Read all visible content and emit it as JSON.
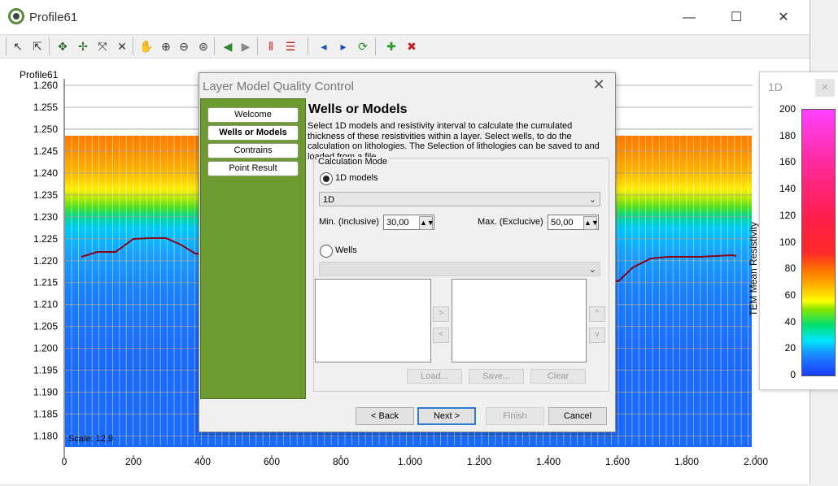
{
  "window": {
    "title": "Profile61",
    "minimize": "—",
    "maximize": "☐",
    "close": "✕"
  },
  "toolbar": {
    "icons": [
      "select-arrow-icon",
      "multi-select-icon",
      "node-edit-icon",
      "node-add-icon",
      "node-move-icon",
      "delete-icon",
      "pan-hand-icon",
      "zoom-in-icon",
      "zoom-out-icon",
      "zoom-extent-icon",
      "back-arrow-icon",
      "forward-arrow-icon",
      "vertical-lines-icon",
      "horizontal-lines-icon",
      "previous-icon",
      "next-icon",
      "refresh-icon",
      "add-model-icon",
      "remove-model-icon"
    ]
  },
  "plot": {
    "profile_label": "Profile61",
    "scale_label": "Scale: 12,9",
    "y_ticks": [
      "1.260",
      "1.255",
      "1.250",
      "1.245",
      "1.240",
      "1.235",
      "1.230",
      "1.225",
      "1.220",
      "1.215",
      "1.210",
      "1.205",
      "1.200",
      "1.195",
      "1.190",
      "1.185",
      "1.180"
    ],
    "x_ticks": [
      "0",
      "200",
      "400",
      "600",
      "800",
      "1.000",
      "1.200",
      "1.400",
      "1.600",
      "1.800",
      "2.000"
    ]
  },
  "dialog": {
    "title": "Layer Model Quality Control",
    "close": "✕",
    "nav": [
      "Welcome",
      "Wells or Models",
      "Contrains",
      "Point Result"
    ],
    "active_nav": "Wells or Models",
    "heading": "Wells or Models",
    "description": "Select 1D models and resistivity interval to calculate the cumulated thickness of these resistivities within a layer. Select wells, to do the calculation on lithologies. The Selection of lithologies can be saved to and loaded from a file.",
    "group_label": "Calculation Mode",
    "radio_models": "1D models",
    "models_value": "1D",
    "min_label": "Min. (Inclusive)",
    "min_value": "30,00",
    "max_label": "Max. (Exclucive)",
    "max_value": "50,00",
    "radio_wells": "Wells",
    "move_right": ">",
    "move_left": "<",
    "move_up": "^",
    "move_down": "v",
    "load": "Load...",
    "save": "Save...",
    "clear": "Clear",
    "back": "< Back",
    "next": "Next >",
    "finish": "Finish",
    "cancel": "Cancel"
  },
  "legend": {
    "title": "1D",
    "close": "✕",
    "ticks": [
      "200",
      "180",
      "160",
      "140",
      "120",
      "100",
      "80",
      "60",
      "40",
      "20",
      "0"
    ],
    "label": "TEM Mean Resistivity"
  }
}
